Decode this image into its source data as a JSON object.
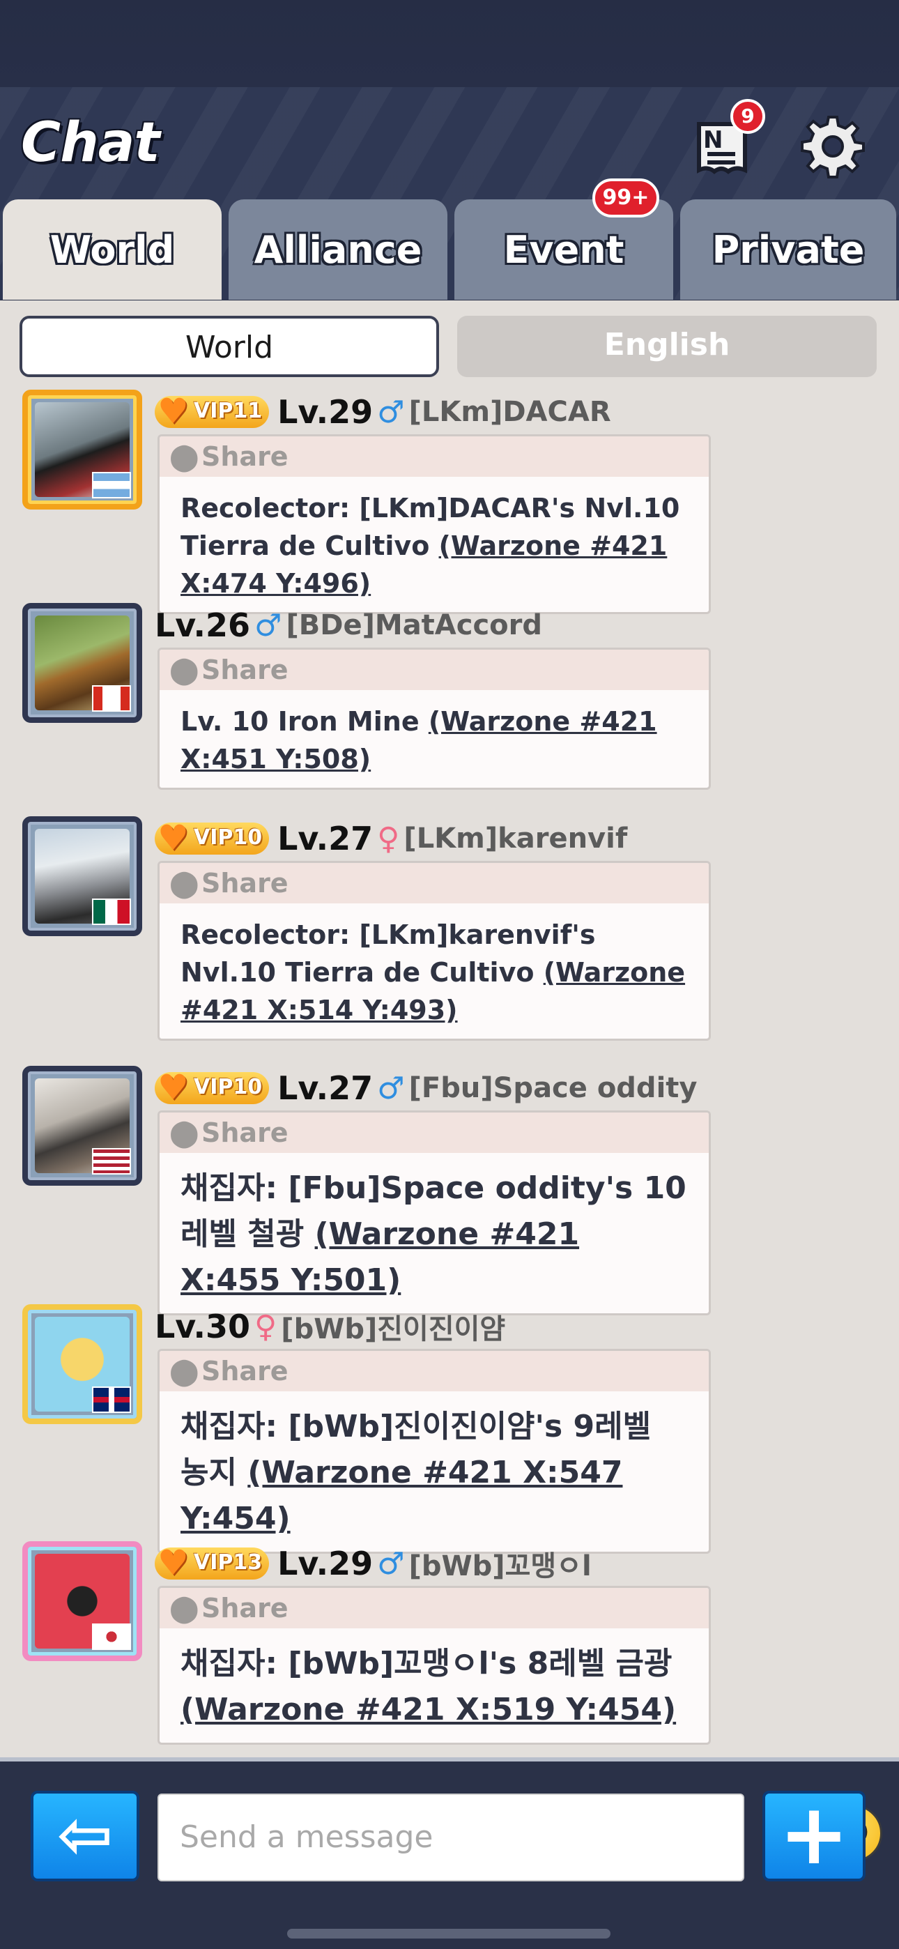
{
  "header": {
    "title": "Chat",
    "notice_badge": "9",
    "event_badge": "99+"
  },
  "tabs": [
    {
      "label": "World"
    },
    {
      "label": "Alliance"
    },
    {
      "label": "Event"
    },
    {
      "label": "Private"
    }
  ],
  "language": {
    "world": "World",
    "english": "English"
  },
  "messages": [
    {
      "vip": "VIP11",
      "level": "Lv.29",
      "gender": "male",
      "name": "[LKm]DACAR",
      "share": "Share",
      "text_plain": "Recolector: [LKm]DACAR's Nvl.10 Tierra de Cultivo ",
      "link": "(Warzone #421 X:474  Y:496)"
    },
    {
      "vip": "",
      "level": "Lv.26",
      "gender": "male",
      "name": "[BDe]MatAccord",
      "share": "Share",
      "text_plain": "Lv. 10 Iron Mine ",
      "link": "(Warzone #421 X:451 Y:508)"
    },
    {
      "vip": "VIP10",
      "level": "Lv.27",
      "gender": "female",
      "name": "[LKm]karenvif",
      "share": "Share",
      "text_plain": "Recolector: [LKm]karenvif's Nvl.10 Tierra de Cultivo ",
      "link": "(Warzone #421 X:514 Y:493)"
    },
    {
      "vip": "VIP10",
      "level": "Lv.27",
      "gender": "male",
      "name": "[Fbu]Space oddity",
      "share": "Share",
      "text_plain": "채집자: [Fbu]Space oddity's 10레벨 철광 ",
      "link": "(Warzone #421 X:455  Y:501)"
    },
    {
      "vip": "",
      "level": "Lv.30",
      "gender": "female",
      "name": "[bWb]진이진이얌",
      "share": "Share",
      "text_plain": "채집자: [bWb]진이진이얌's 9레벨 농지 ",
      "link": "(Warzone #421 X:547  Y:454)"
    },
    {
      "vip": "VIP13",
      "level": "Lv.29",
      "gender": "male",
      "name": "[bWb]꼬맹ㅇl",
      "share": "Share",
      "text_plain": "채집자: [bWb]꼬맹ㅇl's 8레벨 금광 ",
      "link": "(Warzone #421 X:519  Y:454)"
    }
  ],
  "composer": {
    "placeholder": "Send a message"
  },
  "icons": {
    "notice": "notice-board-icon",
    "settings": "gear-icon",
    "back": "arrow-left-icon",
    "add": "plus-icon",
    "emoji": "smiley-emoji-icon",
    "share": "location-pin-icon"
  },
  "colors": {
    "accent_blue": "#1a9cf5",
    "badge_red": "#e0202c",
    "vip_gold": "#f3a51c",
    "background": "#e3dfdb"
  }
}
